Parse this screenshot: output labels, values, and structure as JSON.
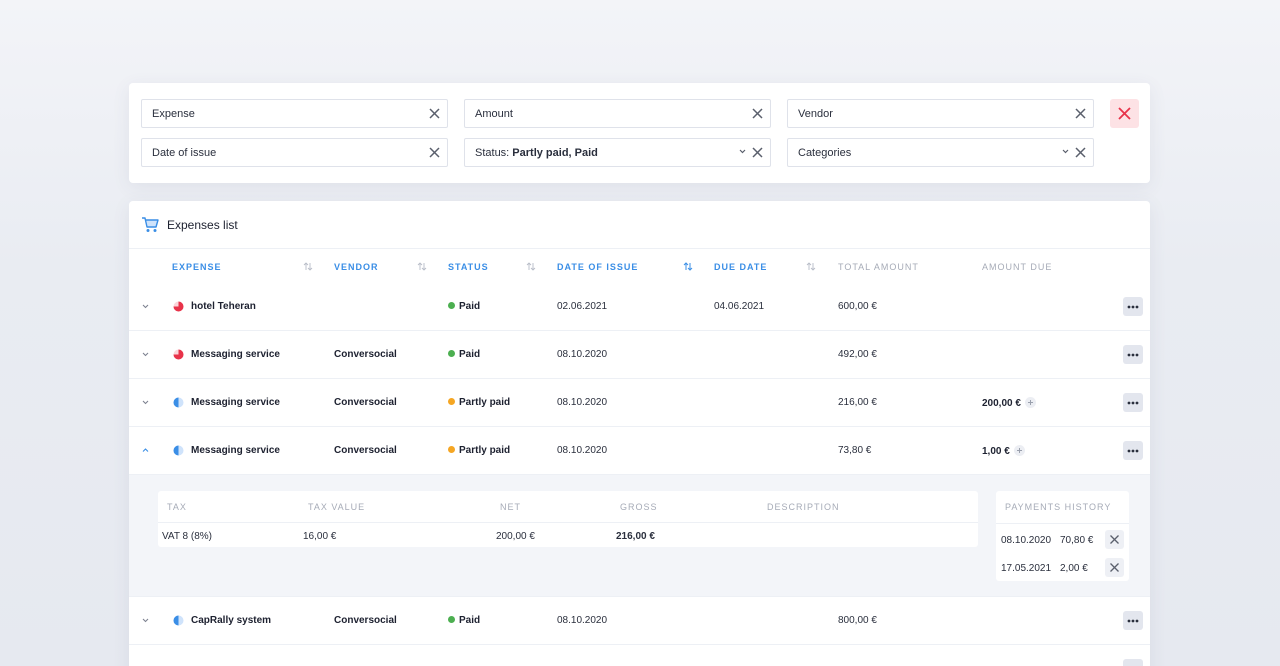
{
  "filters": [
    {
      "label": "Expense",
      "value": "",
      "has_dropdown": false
    },
    {
      "label": "Amount",
      "value": "",
      "has_dropdown": false
    },
    {
      "label": "Vendor",
      "value": "",
      "has_dropdown": false
    },
    {
      "label": "Date of issue",
      "value": "",
      "has_dropdown": false
    },
    {
      "label": "Status: ",
      "value": "Partly paid, Paid",
      "has_dropdown": true
    },
    {
      "label": "Categories",
      "value": "",
      "has_dropdown": true
    }
  ],
  "card": {
    "title": "Expenses list",
    "icon": "cart-icon"
  },
  "columns": {
    "expense": "Expense",
    "vendor": "Vendor",
    "status": "Status",
    "date_of_issue": "Date of issue",
    "due_date": "Due date",
    "total_amount": "Total amount",
    "amount_due": "Amount due"
  },
  "rows": [
    {
      "expense": "hotel Teheran",
      "vendor": "",
      "status": "Paid",
      "date_of_issue": "02.06.2021",
      "due_date": "04.06.2021",
      "total_amount": "600,00 €",
      "amount_due": "",
      "expanded": false
    },
    {
      "expense": "Messaging service",
      "vendor": "Conversocial",
      "status": "Paid",
      "date_of_issue": "08.10.2020",
      "due_date": "",
      "total_amount": "492,00 €",
      "amount_due": "",
      "expanded": false
    },
    {
      "expense": "Messaging service",
      "vendor": "Conversocial",
      "status": "Partly paid",
      "date_of_issue": "08.10.2020",
      "due_date": "",
      "total_amount": "216,00 €",
      "amount_due": "200,00 €",
      "expanded": false
    },
    {
      "expense": "Messaging service",
      "vendor": "Conversocial",
      "status": "Partly paid",
      "date_of_issue": "08.10.2020",
      "due_date": "",
      "total_amount": "73,80 €",
      "amount_due": "1,00 €",
      "expanded": true
    },
    {
      "expense": "CapRally system",
      "vendor": "Conversocial",
      "status": "Paid",
      "date_of_issue": "08.10.2020",
      "due_date": "",
      "total_amount": "800,00 €",
      "amount_due": "",
      "expanded": false
    }
  ],
  "tax_table": {
    "headers": {
      "tax": "Tax",
      "tax_value": "Tax value",
      "net": "Net",
      "gross": "Gross",
      "description": "Description"
    },
    "row": {
      "tax": "VAT 8 (8%)",
      "tax_value": "16,00 €",
      "net": "200,00 €",
      "gross": "216,00 €",
      "description": ""
    }
  },
  "payments_history": {
    "title": "Payments history",
    "items": [
      {
        "date": "08.10.2020",
        "amount": "70,80 €"
      },
      {
        "date": "17.05.2021",
        "amount": "2,00 €"
      }
    ]
  },
  "colors": {
    "accent": "#3a8ee6",
    "paid": "#4caf50",
    "partly_paid": "#f5a623",
    "danger": "#e8334a"
  }
}
